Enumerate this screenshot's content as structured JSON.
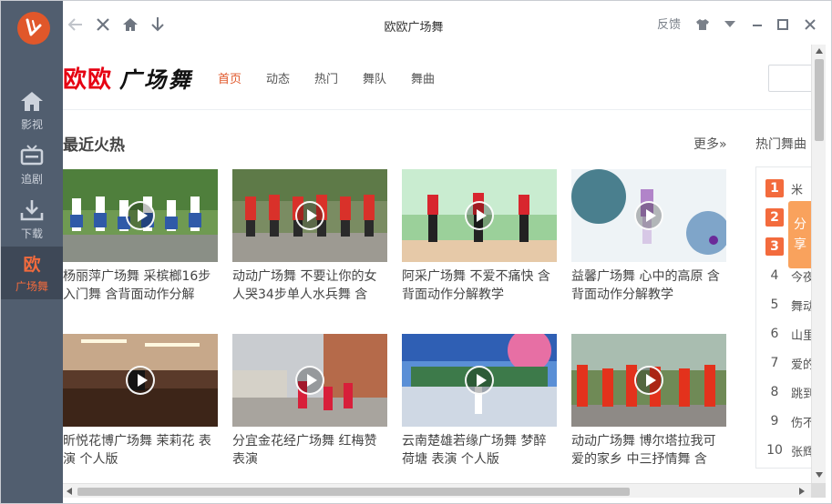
{
  "window": {
    "title": "欧欧广场舞",
    "feedback": "反馈"
  },
  "sidebar": {
    "items": [
      {
        "label": "影视",
        "icon": "home-icon"
      },
      {
        "label": "追剧",
        "icon": "tv-icon"
      },
      {
        "label": "下载",
        "icon": "download-icon"
      },
      {
        "label": "广场舞",
        "icon_text": "欧",
        "active": true
      }
    ]
  },
  "site": {
    "logo_red": "欧欧",
    "logo_black": "广场舞",
    "nav": [
      {
        "label": "首页",
        "active": true
      },
      {
        "label": "动态"
      },
      {
        "label": "热门"
      },
      {
        "label": "舞队"
      },
      {
        "label": "舞曲"
      }
    ]
  },
  "section": {
    "title": "最近火热",
    "more": "更多»",
    "hot_title": "热门舞曲"
  },
  "videos": [
    {
      "title": "杨丽萍广场舞 采槟榔16步入门舞 含背面动作分解"
    },
    {
      "title": "动动广场舞 不要让你的女人哭34步单人水兵舞 含"
    },
    {
      "title": "阿采广场舞 不爱不痛快 含背面动作分解教学"
    },
    {
      "title": "益馨广场舞 心中的高原 含背面动作分解教学"
    },
    {
      "title": "昕悦花博广场舞 茉莉花 表演 个人版"
    },
    {
      "title": "分宜金花经广场舞 红梅赞 表演"
    },
    {
      "title": "云南楚雄若缘广场舞 梦醉荷塘 表演 个人版"
    },
    {
      "title": "动动广场舞 博尔塔拉我可爱的家乡 中三抒情舞 含"
    }
  ],
  "hot_list": [
    {
      "rank": "1",
      "name": "米"
    },
    {
      "rank": "2",
      "name": ""
    },
    {
      "rank": "3",
      "name": ""
    },
    {
      "rank": "4",
      "name": "今夜"
    },
    {
      "rank": "5",
      "name": "舞动"
    },
    {
      "rank": "6",
      "name": "山里"
    },
    {
      "rank": "7",
      "name": "爱的"
    },
    {
      "rank": "8",
      "name": "跳到"
    },
    {
      "rank": "9",
      "name": "伤不"
    },
    {
      "rank": "10",
      "name": "张辉"
    }
  ],
  "share_tab": {
    "line1": "分",
    "line2": "享"
  },
  "colors": {
    "sidebar": "#515e6f",
    "accent": "#e0572a",
    "logo_red": "#e60012",
    "share": "#f9a25d"
  }
}
